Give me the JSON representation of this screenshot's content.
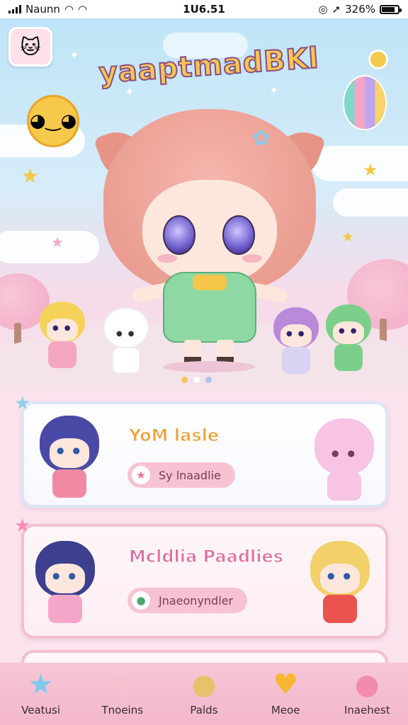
{
  "status_bar": {
    "carrier": "Naunn",
    "time": "1U6.51",
    "battery": "326%"
  },
  "header": {
    "app_title": "yaaptmadBKl",
    "logo_icon": "cat-face-icon"
  },
  "hero": {
    "pager_total": 3,
    "pager_active": 1,
    "colors": {
      "active_dot": "#f5c65a",
      "inactive_dot": "#ffffff",
      "third_dot": "#a8c6ea"
    }
  },
  "cards": [
    {
      "title": "YoM lasle",
      "button_label": "Sy lnaadlie",
      "button_icon": "star-icon"
    },
    {
      "title": "Mcldlia Paadlies",
      "button_label": "Jnaeonyndler",
      "button_icon": "chat-bubble-icon"
    }
  ],
  "bottom_nav": {
    "items": [
      {
        "label": "Veatusi",
        "icon": "star-character-icon"
      },
      {
        "label": "Tnoeins",
        "icon": "bunny-face-icon"
      },
      {
        "label": "Palds",
        "icon": "bear-face-icon"
      },
      {
        "label": "Meoe",
        "icon": "heart-icon"
      },
      {
        "label": "Inaehest",
        "icon": "pig-face-icon"
      }
    ]
  }
}
